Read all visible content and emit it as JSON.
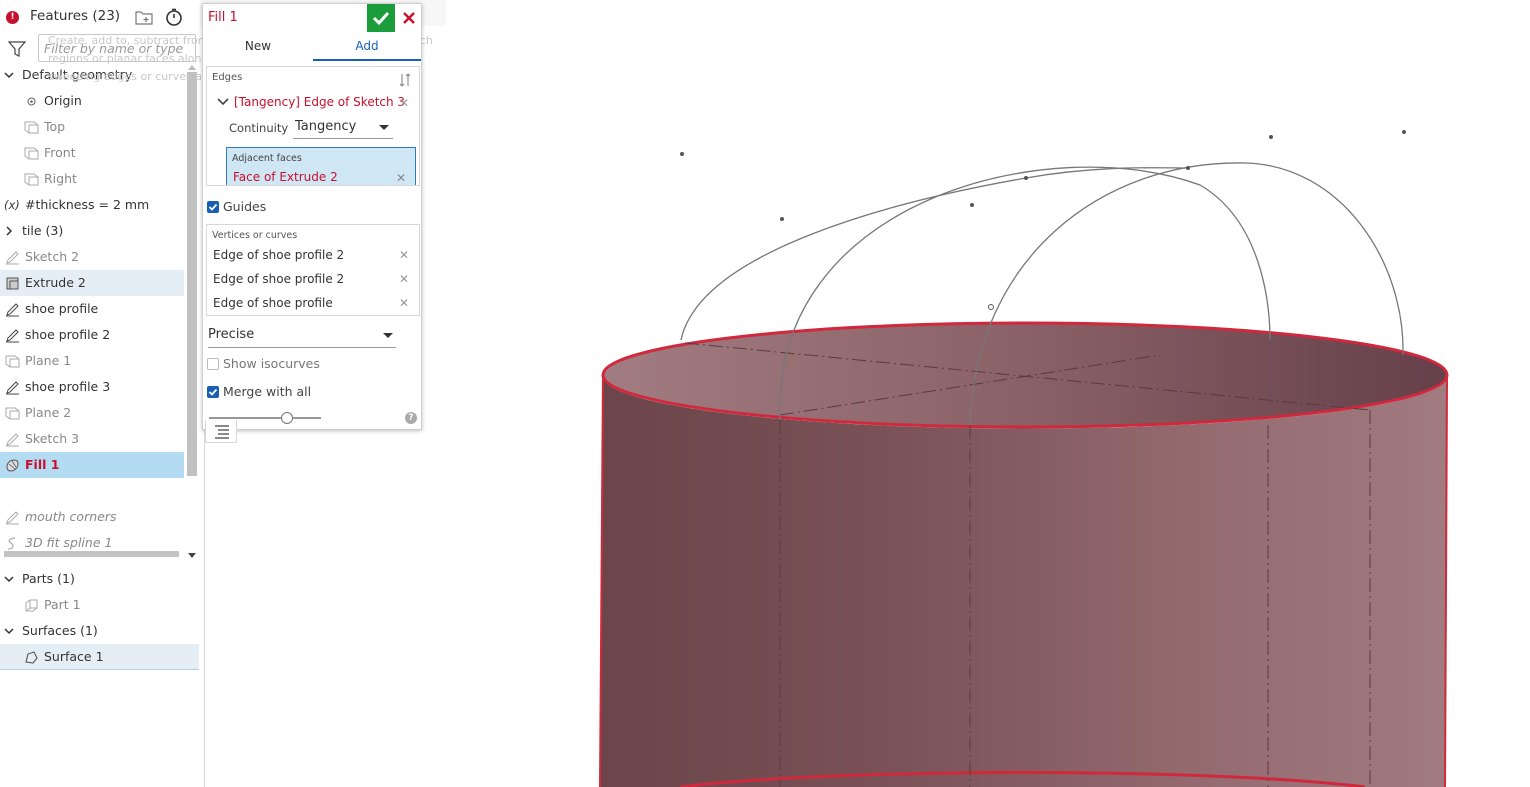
{
  "feature_panel": {
    "title": "Features (23)",
    "filter_placeholder": "Filter by name or type",
    "tree": [
      {
        "label": "Default geometry",
        "kind": "group",
        "icon": "chevron-down-icon"
      },
      {
        "label": "Origin",
        "kind": "origin",
        "icon": "origin-icon"
      },
      {
        "label": "Top",
        "kind": "plane",
        "icon": "plane-icon"
      },
      {
        "label": "Front",
        "kind": "plane",
        "icon": "plane-icon"
      },
      {
        "label": "Right",
        "kind": "plane",
        "icon": "plane-icon"
      },
      {
        "label": "#thickness = 2 mm",
        "kind": "variable",
        "icon": "variable-icon"
      },
      {
        "label": "tile (3)",
        "kind": "folder",
        "icon": "chevron-right-icon"
      },
      {
        "label": "Sketch 2",
        "kind": "sketch",
        "icon": "sketch-icon"
      },
      {
        "label": "Extrude 2",
        "kind": "extrude",
        "icon": "extrude-icon"
      },
      {
        "label": "shoe profile",
        "kind": "sketch",
        "icon": "sketch-icon"
      },
      {
        "label": "shoe profile 2",
        "kind": "sketch",
        "icon": "sketch-icon"
      },
      {
        "label": "Plane 1",
        "kind": "plane",
        "icon": "plane-icon"
      },
      {
        "label": "shoe profile 3",
        "kind": "sketch",
        "icon": "sketch-icon"
      },
      {
        "label": "Plane 2",
        "kind": "plane",
        "icon": "plane-icon"
      },
      {
        "label": "Sketch 3",
        "kind": "sketch",
        "icon": "sketch-icon"
      },
      {
        "label": "Fill 1",
        "kind": "fill",
        "icon": "fill-icon"
      },
      {
        "label": "mouth corners",
        "kind": "sketch",
        "icon": "sketch-icon"
      },
      {
        "label": "3D fit spline 1",
        "kind": "spline",
        "icon": "spline-icon"
      }
    ],
    "parts_header": "Parts (1)",
    "part_1": "Part 1",
    "surfaces_header": "Surfaces (1)",
    "surface_1": "Surface 1"
  },
  "tooltip": {
    "text": "Create, add to, subtract from, or intersect parts by sweeping a sketch regions or planar faces along a path. Create or add to surfaces by sweeping edges or curves along a path."
  },
  "fill_dialog": {
    "title": "Fill 1",
    "tab_new": "New",
    "tab_add": "Add",
    "edges_label": "Edges",
    "edge_item": "[Tangency] Edge of Sketch 3",
    "continuity_label": "Continuity",
    "continuity_value": "Tangency",
    "adjacent_faces_label": "Adjacent faces",
    "adjacent_face": "Face of Extrude 2",
    "guides_label": "Guides",
    "guides_checked": true,
    "vertices_label": "Vertices or curves",
    "vertices": [
      "Edge of shoe profile 2",
      "Edge of shoe profile 2",
      "Edge of shoe profile"
    ],
    "precision_value": "Precise",
    "show_isocurves_label": "Show isocurves",
    "show_isocurves_checked": false,
    "merge_label": "Merge with all",
    "merge_checked": true,
    "slider_value": 0.7
  },
  "colors": {
    "accent_red": "#c8102e",
    "accent_blue": "#1a5fb4",
    "ok_green": "#1c9c3a",
    "selection_blue": "#b3dbf2",
    "cylinder_body": "#8a5f64",
    "edge_highlight": "#d0283c"
  }
}
